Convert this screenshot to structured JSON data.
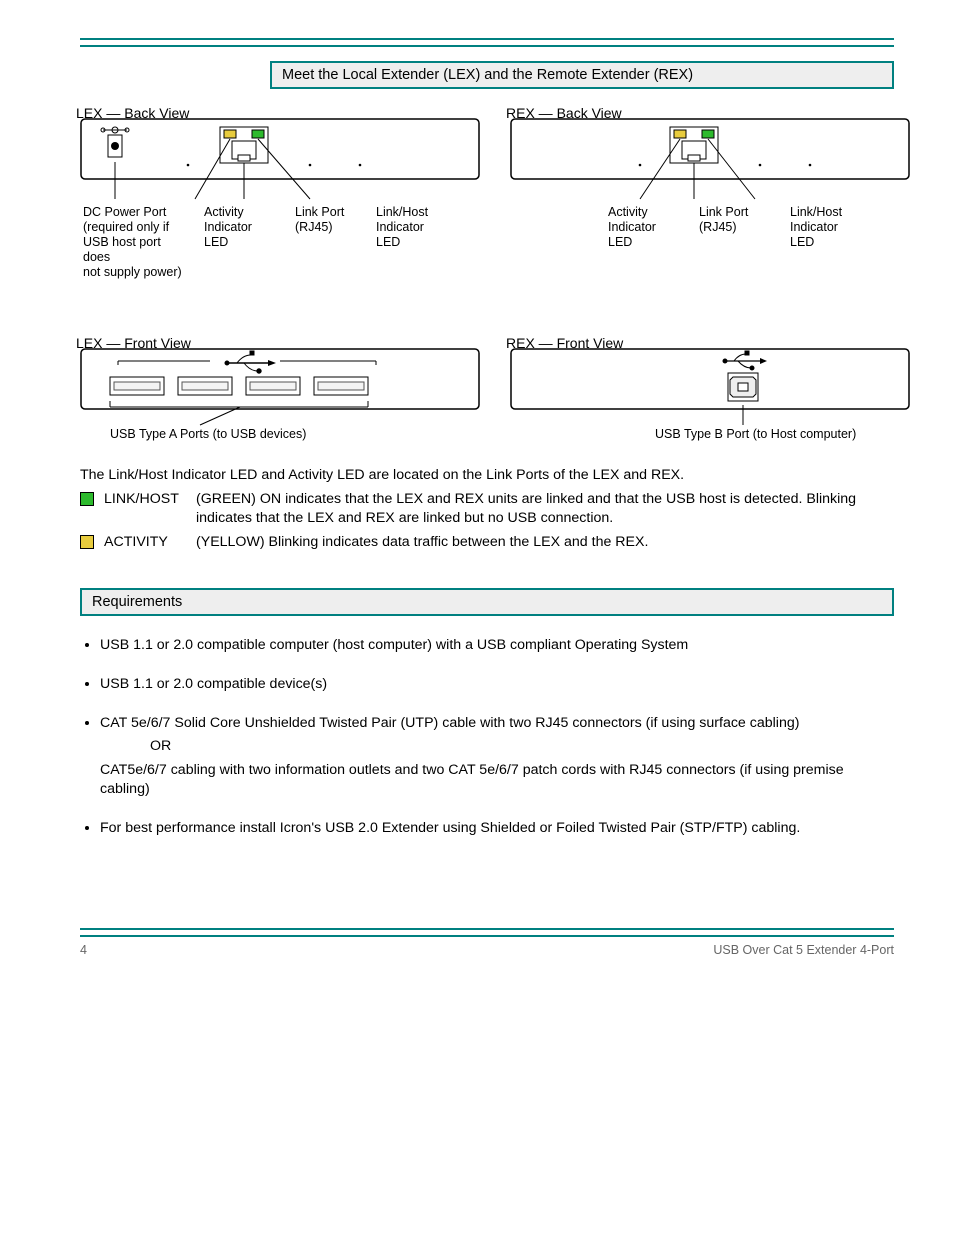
{
  "section1_title": "Meet the Local Extender (LEX) and the Remote Extender (REX)",
  "section2_title": "Requirements",
  "panels": {
    "lex_back": {
      "title": "LEX — Back View",
      "label1": "DC Power Port\n(required only if\nUSB host port does\nnot supply power)",
      "label2": "Link Port\n(RJ45)",
      "led_act": "Activity\nIndicator LED",
      "led_host": "Link/Host Indicator\nLED"
    },
    "rex_back": {
      "title": "REX — Back View",
      "label1": "Link Port\n(RJ45)",
      "led_act": "Activity\nIndicator\nLED",
      "led_host": "Link/Host Indicator\nLED"
    },
    "lex_front": {
      "title": "LEX — Front View",
      "label1": "USB Type A Ports (to USB devices)"
    },
    "rex_front": {
      "title": "REX — Front View",
      "label1": "USB Type B Port (to Host computer)"
    }
  },
  "leds_intro": "The Link/Host Indicator LED and Activity LED are located on the Link Ports of the LEX and REX.",
  "led_link": {
    "name": "LINK/HOST",
    "desc": "(GREEN) ON indicates that the LEX and REX units are linked and that the USB host is detected. Blinking indicates that the LEX and REX are linked but no USB connection."
  },
  "led_activity": {
    "name": "ACTIVITY",
    "desc": "(YELLOW) Blinking indicates data traffic between the LEX and the REX."
  },
  "requirements": [
    {
      "main": "USB 1.1 or 2.0 compatible computer (host computer) with a USB compliant Operating System"
    },
    {
      "main": "USB 1.1 or 2.0 compatible device(s)"
    },
    {
      "main": "CAT 5e/6/7 Solid Core Unshielded Twisted Pair (UTP) cable with two RJ45 connectors (if using surface cabling)",
      "or": "OR",
      "sub": "CAT5e/6/7 cabling with two information outlets and two CAT 5e/6/7 patch cords with RJ45 connectors (if using premise cabling)"
    },
    {
      "main": "For best performance install Icron's USB 2.0 Extender using Shielded or Foiled Twisted Pair (STP/FTP) cabling."
    }
  ],
  "footer": {
    "left": "4",
    "right": "USB Over Cat 5 Extender 4-Port"
  }
}
